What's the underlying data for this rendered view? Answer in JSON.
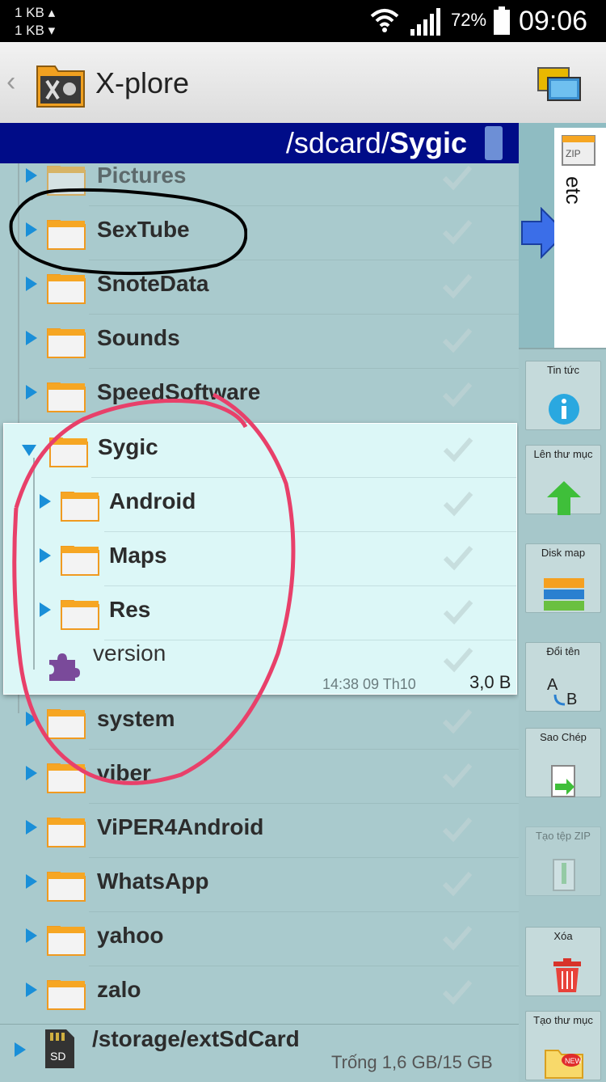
{
  "status_bar": {
    "net_up": "1 KB ▴",
    "net_down": "1 KB ▾",
    "battery_percent": "72%",
    "time": "09:06"
  },
  "app_bar": {
    "title": "X-plore"
  },
  "path_bar": {
    "path_prefix": "/sdcard/",
    "path_current": "Sygic"
  },
  "folders_before": [
    {
      "name": "Pictures"
    },
    {
      "name": "SexTube"
    },
    {
      "name": "SnoteData"
    },
    {
      "name": "Sounds"
    },
    {
      "name": "SpeedSoftware"
    }
  ],
  "expanded_folder": {
    "name": "Sygic",
    "children": [
      {
        "name": "Android"
      },
      {
        "name": "Maps"
      },
      {
        "name": "Res"
      }
    ],
    "file": {
      "name": "version",
      "modified": "14:38 09 Th10",
      "size": "3,0 B"
    }
  },
  "folders_after": [
    {
      "name": "system"
    },
    {
      "name": "viber"
    },
    {
      "name": "ViPER4Android"
    },
    {
      "name": "WhatsApp"
    },
    {
      "name": "yahoo"
    },
    {
      "name": "zalo"
    }
  ],
  "storage": {
    "path": "/storage/extSdCard",
    "free": "Trống 1,6 GB/15 GB"
  },
  "side_tab": {
    "label": "etc"
  },
  "actions": [
    {
      "label": "Tin tức",
      "icon": "info-icon"
    },
    {
      "label": "Lên thư mục",
      "icon": "up-arrow-icon"
    },
    {
      "label": "Disk map",
      "icon": "disk-map-icon"
    },
    {
      "label": "Đổi tên",
      "icon": "rename-icon"
    },
    {
      "label": "Sao Chép",
      "icon": "copy-icon"
    },
    {
      "label": "Tạo tệp ZIP",
      "icon": "zip-icon"
    },
    {
      "label": "Xóa",
      "icon": "trash-icon"
    },
    {
      "label": "Tạo thư mục",
      "icon": "new-folder-icon"
    }
  ],
  "colors": {
    "path_bar": "#000c88",
    "list_background": "#a9cacd",
    "expanded_background": "#dcf7f7",
    "tree_arrow": "#1a8fd8",
    "annotation_pink": "#e8406a",
    "annotation_black": "#000000"
  }
}
